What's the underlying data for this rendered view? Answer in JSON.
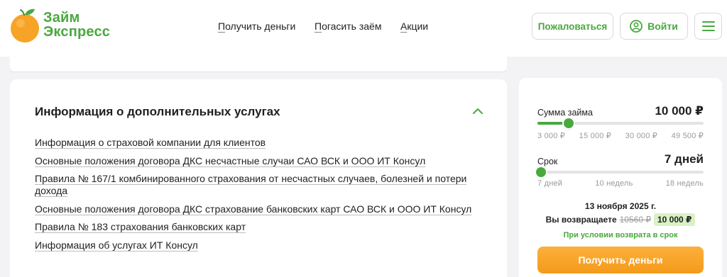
{
  "header": {
    "logo": {
      "line1": "Займ",
      "line2": "Экспресс"
    },
    "nav": [
      {
        "first": "П",
        "rest": "олучить деньги"
      },
      {
        "first": "П",
        "rest": "огасить заём"
      },
      {
        "first": "А",
        "rest": "кции"
      }
    ],
    "complain_label": "Пожаловаться",
    "login_label": "Войти"
  },
  "info_section": {
    "title": "Информация о дополнительных услугах",
    "links": [
      "Информация о страховой компании для клиентов",
      "Основные положения договора ДКС несчастные случаи САО ВСК и ООО ИТ Консул",
      "Правила № 167/1 комбинированного страхования от несчастных случаев, болезней и потери дохода",
      "Основные положения договора ДКС страхование банковских карт САО ВСК и ООО ИТ Консул",
      "Правила № 183 страхования банковских карт",
      "Информация об услугах ИТ Консул"
    ]
  },
  "calculator": {
    "amount_label": "Сумма займа",
    "amount_value": "10 000 ₽",
    "amount_slider_fraction": 0.19,
    "amount_ticks": [
      "3 000 ₽",
      "15 000 ₽",
      "30 000 ₽",
      "49 500 ₽"
    ],
    "term_label": "Срок",
    "term_value": "7 дней",
    "term_slider_fraction": 0.0,
    "term_ticks": [
      "7 дней",
      "10 недель",
      "18 недель"
    ],
    "date": "13 ноября 2025 г.",
    "return_label": "Вы возвращаете",
    "return_old": "10560 ₽",
    "return_new": "10 000 ₽",
    "condition": "При условии возврата в срок",
    "cta_label": "Получить деньги"
  },
  "colors": {
    "brand_green": "#4aa83f",
    "accent_orange": "#f7a326",
    "highlight": "#d9f2c5"
  }
}
